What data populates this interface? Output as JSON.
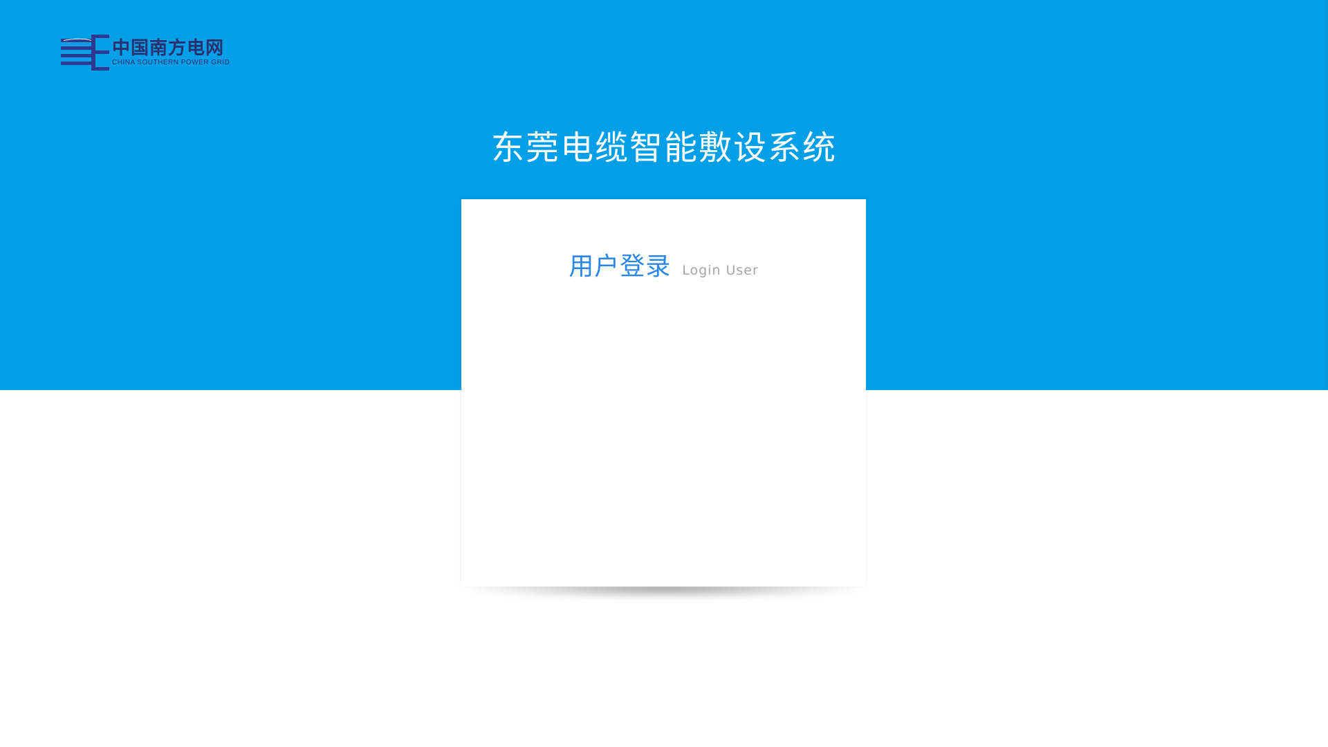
{
  "header": {
    "logo": {
      "name_cn": "中国南方电网",
      "name_en": "CHINA SOUTHERN POWER GRID",
      "icon": "csg-logo-icon",
      "color": "#2a2f6e"
    },
    "background_color": "#019fe8"
  },
  "main": {
    "system_title": "东莞电缆智能敷设系统"
  },
  "login_card": {
    "title_cn": "用户登录",
    "title_en": "Login User",
    "title_color": "#2a86e8",
    "subtitle_color": "#a6a6a6"
  }
}
